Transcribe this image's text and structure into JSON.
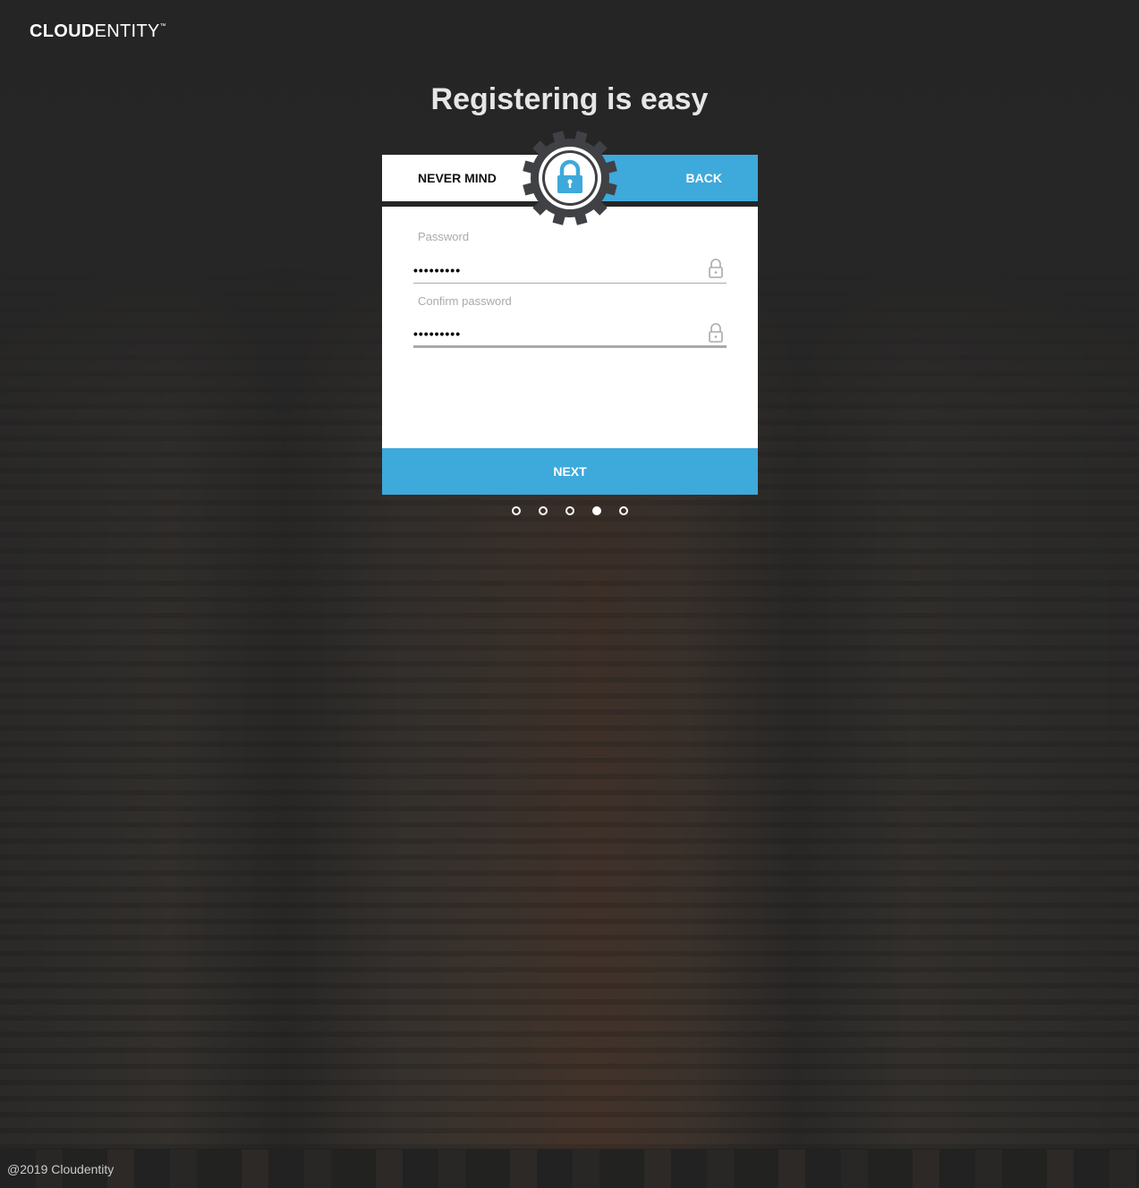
{
  "brand": {
    "bold": "CLOUD",
    "light": "ENTITY",
    "tm": "™"
  },
  "title": "Registering is easy",
  "nav": {
    "never_mind": "NEVER MIND",
    "back": "BACK"
  },
  "form": {
    "password": {
      "label": "Password",
      "value": "•••••••••"
    },
    "confirm": {
      "label": "Confirm password",
      "value": "•••••••••"
    }
  },
  "next": "NEXT",
  "steps": {
    "total": 5,
    "current": 4
  },
  "footer": "@2019 Cloudentity",
  "colors": {
    "accent": "#3ea9db",
    "gear": "#404145"
  }
}
